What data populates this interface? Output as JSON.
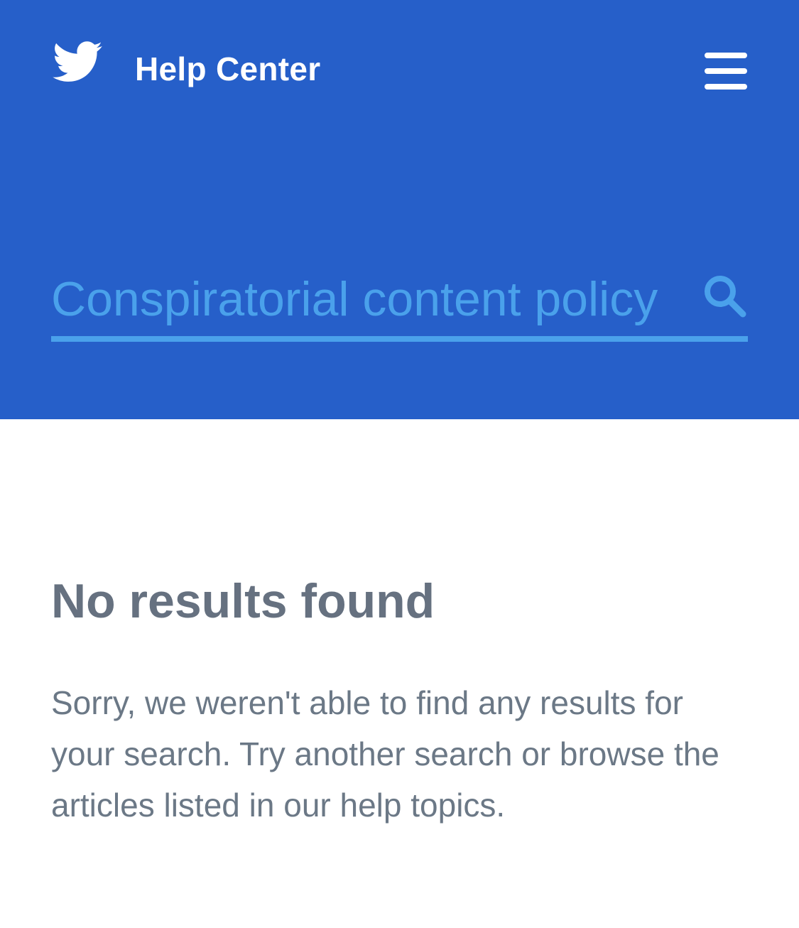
{
  "header": {
    "logo_icon": "twitter-bird-icon",
    "title": "Help Center",
    "menu_icon": "hamburger-menu-icon"
  },
  "search": {
    "value": "Conspiratorial content policy",
    "icon": "search-icon"
  },
  "results": {
    "title": "No results found",
    "message": "Sorry, we weren't able to find any results for your search. Try another search or browse the articles listed in our help topics."
  },
  "colors": {
    "header_background": "#265fc9",
    "search_accent": "#4aa1eb",
    "heading_text": "#667180",
    "body_text": "#6b7886"
  }
}
